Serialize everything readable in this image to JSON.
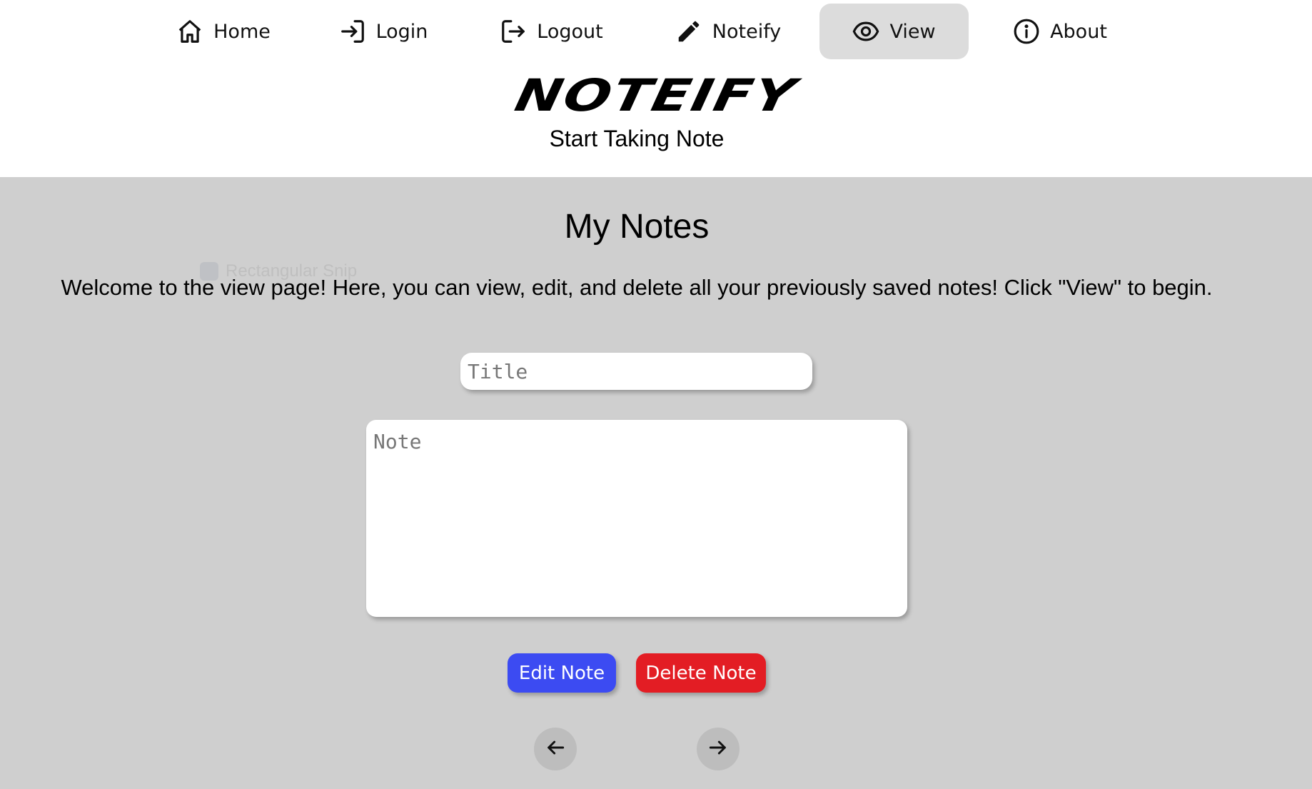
{
  "nav": {
    "items": [
      {
        "label": "Home",
        "icon": "home-icon"
      },
      {
        "label": "Login",
        "icon": "login-icon"
      },
      {
        "label": "Logout",
        "icon": "logout-icon"
      },
      {
        "label": "Noteify",
        "icon": "pencil-icon"
      },
      {
        "label": "View",
        "icon": "eye-icon",
        "active": true
      },
      {
        "label": "About",
        "icon": "info-icon"
      }
    ]
  },
  "header": {
    "logo": "NOTEIFY",
    "tagline": "Start Taking Note"
  },
  "main": {
    "title": "My Notes",
    "welcome": "Welcome to the view page! Here, you can view, edit, and delete all your previously saved notes! Click \"View\" to begin.",
    "ghost_overlay": "Rectangular Snip",
    "title_input": {
      "placeholder": "Title",
      "value": ""
    },
    "note_input": {
      "placeholder": "Note",
      "value": ""
    },
    "edit_label": "Edit Note",
    "delete_label": "Delete Note",
    "prev_icon": "arrow-left-icon",
    "next_icon": "arrow-right-icon"
  },
  "colors": {
    "page_bg": "#cfcfcf",
    "header_bg": "#ffffff",
    "active_nav": "#dcdcdc",
    "edit_button": "#3c4bf2",
    "delete_button": "#e31d24",
    "arrow_button": "#bdbdbd"
  }
}
